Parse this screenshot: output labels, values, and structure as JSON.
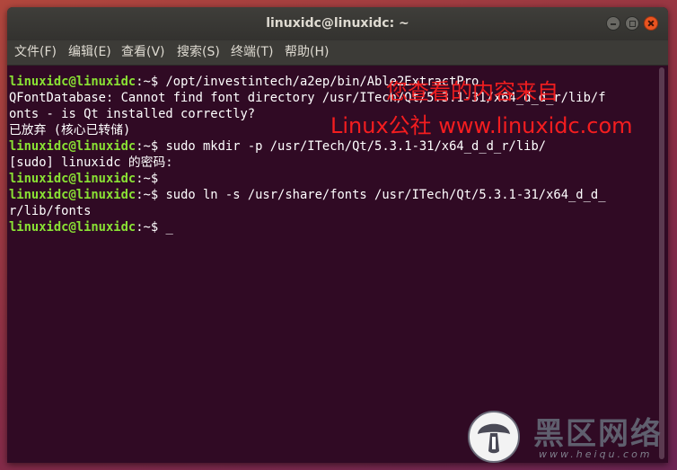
{
  "window": {
    "title": "linuxidc@linuxidc: ~"
  },
  "menu": {
    "file": "文件(F)",
    "edit": "编辑(E)",
    "view": "查看(V)",
    "search": "搜索(S)",
    "terminal": "终端(T)",
    "help": "帮助(H)"
  },
  "terminal": {
    "lines": [
      {
        "prompt": "linuxidc@linuxidc",
        "path": ":~$ ",
        "text": "/opt/investintech/a2ep/bin/Able2ExtractPro"
      },
      {
        "prompt": "",
        "path": "",
        "text": "QFontDatabase: Cannot find font directory /usr/ITech/Qt/5.3.1-31/x64_d_d_r/lib/f"
      },
      {
        "prompt": "",
        "path": "",
        "text": "onts - is Qt installed correctly?"
      },
      {
        "prompt": "",
        "path": "",
        "text": "已放弃 (核心已转储)"
      },
      {
        "prompt": "linuxidc@linuxidc",
        "path": ":~$ ",
        "text": "sudo mkdir -p /usr/ITech/Qt/5.3.1-31/x64_d_d_r/lib/"
      },
      {
        "prompt": "",
        "path": "",
        "text": "[sudo] linuxidc 的密码:"
      },
      {
        "prompt": "linuxidc@linuxidc",
        "path": ":~$",
        "text": ""
      },
      {
        "prompt": "linuxidc@linuxidc",
        "path": ":~$ ",
        "text": "sudo ln -s /usr/share/fonts /usr/ITech/Qt/5.3.1-31/x64_d_d_"
      },
      {
        "prompt": "",
        "path": "",
        "text": "r/lib/fonts"
      },
      {
        "prompt": "linuxidc@linuxidc",
        "path": ":~$ ",
        "text": "_"
      }
    ]
  },
  "watermarks": {
    "line1": "您查看的内容来自",
    "line2": "Linux公社 www.linuxidc.com"
  },
  "logo": {
    "name": "黑区网络",
    "url": "www.heiqu.com"
  },
  "colors": {
    "terminal_bg": "#300a24",
    "prompt_green": "#8ae234",
    "close_orange": "#e95420",
    "watermark_red": "#ff1f1f"
  },
  "icons": [
    "minimize-icon",
    "maximize-icon",
    "close-icon",
    "mushroom-logo-icon"
  ]
}
